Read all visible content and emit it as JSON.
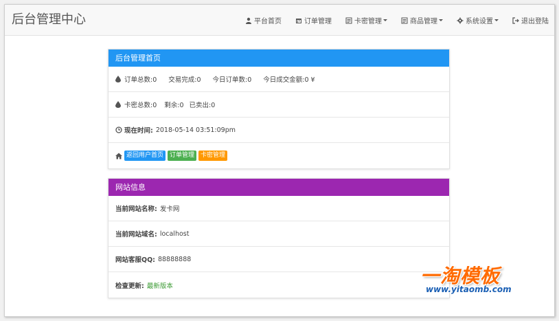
{
  "header": {
    "brand": "后台管理中心",
    "nav": [
      {
        "label": "平台首页",
        "icon": "user-icon",
        "dropdown": false
      },
      {
        "label": "订单管理",
        "icon": "calendar-icon",
        "dropdown": false
      },
      {
        "label": "卡密管理",
        "icon": "list-icon",
        "dropdown": true
      },
      {
        "label": "商品管理",
        "icon": "list-icon",
        "dropdown": true
      },
      {
        "label": "系统设置",
        "icon": "gear-icon",
        "dropdown": true
      },
      {
        "label": "退出登陆",
        "icon": "logout-icon",
        "dropdown": false
      }
    ]
  },
  "panel_home": {
    "title": "后台管理首页",
    "color": "#2196f3",
    "orders_stats": [
      "订单总数:0",
      "交易完成:0",
      "今日订单数:0",
      "今日成交金额:0 ¥"
    ],
    "cards_stats": [
      "卡密总数:0",
      "剩余:0",
      "已卖出:0"
    ],
    "time_label": "现在时间:",
    "time_value": "2018-05-14 03:51:09pm",
    "buttons": [
      {
        "label": "返回用户首页",
        "color": "#2196f3"
      },
      {
        "label": "订单管理",
        "color": "#4caf50"
      },
      {
        "label": "卡密管理",
        "color": "#ff9800"
      }
    ]
  },
  "panel_site": {
    "title": "网站信息",
    "color": "#9c27b0",
    "site_name_label": "当前网站名称:",
    "site_name_value": "发卡网",
    "domain_label": "当前网站域名:",
    "domain_value": "localhost",
    "qq_label": "网站客服QQ:",
    "qq_value": "88888888",
    "update_label": "检查更新:",
    "update_value": "最新版本"
  },
  "watermark": {
    "title": "一淘模板",
    "url": "www.yitaomb.com"
  }
}
